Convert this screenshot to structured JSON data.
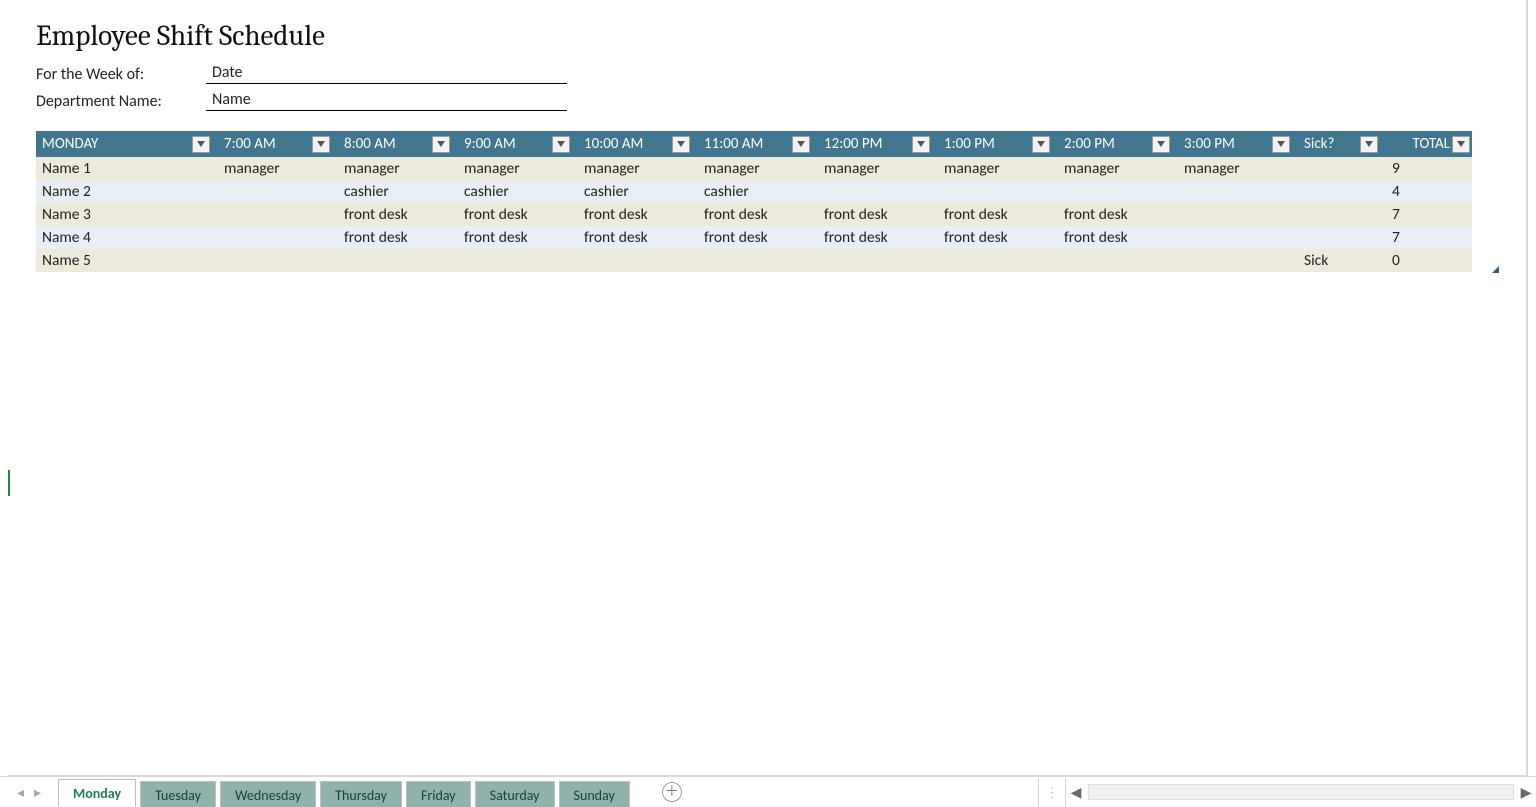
{
  "title": "Employee Shift Schedule",
  "meta": {
    "week_label": "For the Week of:",
    "week_value": "Date",
    "dept_label": "Department Name:",
    "dept_value": "Name"
  },
  "schedule": {
    "day_header": "MONDAY",
    "time_headers": [
      "7:00 AM",
      "8:00 AM",
      "9:00 AM",
      "10:00 AM",
      "11:00 AM",
      "12:00 PM",
      "1:00 PM",
      "2:00 PM",
      "3:00 PM"
    ],
    "sick_header": "Sick?",
    "total_header": "TOTAL",
    "rows": [
      {
        "name": "Name 1",
        "cells": [
          "manager",
          "manager",
          "manager",
          "manager",
          "manager",
          "manager",
          "manager",
          "manager",
          "manager"
        ],
        "sick": "",
        "total": "9"
      },
      {
        "name": "Name 2",
        "cells": [
          "",
          "cashier",
          "cashier",
          "cashier",
          "cashier",
          "",
          "",
          "",
          ""
        ],
        "sick": "",
        "total": "4"
      },
      {
        "name": "Name 3",
        "cells": [
          "",
          "front desk",
          "front desk",
          "front desk",
          "front desk",
          "front desk",
          "front desk",
          "front desk",
          ""
        ],
        "sick": "",
        "total": "7"
      },
      {
        "name": "Name 4",
        "cells": [
          "",
          "front desk",
          "front desk",
          "front desk",
          "front desk",
          "front desk",
          "front desk",
          "front desk",
          ""
        ],
        "sick": "",
        "total": "7"
      },
      {
        "name": "Name 5",
        "cells": [
          "",
          "",
          "",
          "",
          "",
          "",
          "",
          "",
          ""
        ],
        "sick": "Sick",
        "total": "0"
      }
    ]
  },
  "tabs": {
    "items": [
      {
        "label": "Monday",
        "active": true
      },
      {
        "label": "Tuesday",
        "active": false
      },
      {
        "label": "Wednesday",
        "active": false
      },
      {
        "label": "Thursday",
        "active": false
      },
      {
        "label": "Friday",
        "active": false
      },
      {
        "label": "Saturday",
        "active": false
      },
      {
        "label": "Sunday",
        "active": false
      }
    ]
  },
  "glyphs": {
    "nav_prev": "◂",
    "nav_next": "▸",
    "add_plus": "＋",
    "splitter": "⋮",
    "scroll_left": "◀",
    "scroll_right": "▶"
  }
}
